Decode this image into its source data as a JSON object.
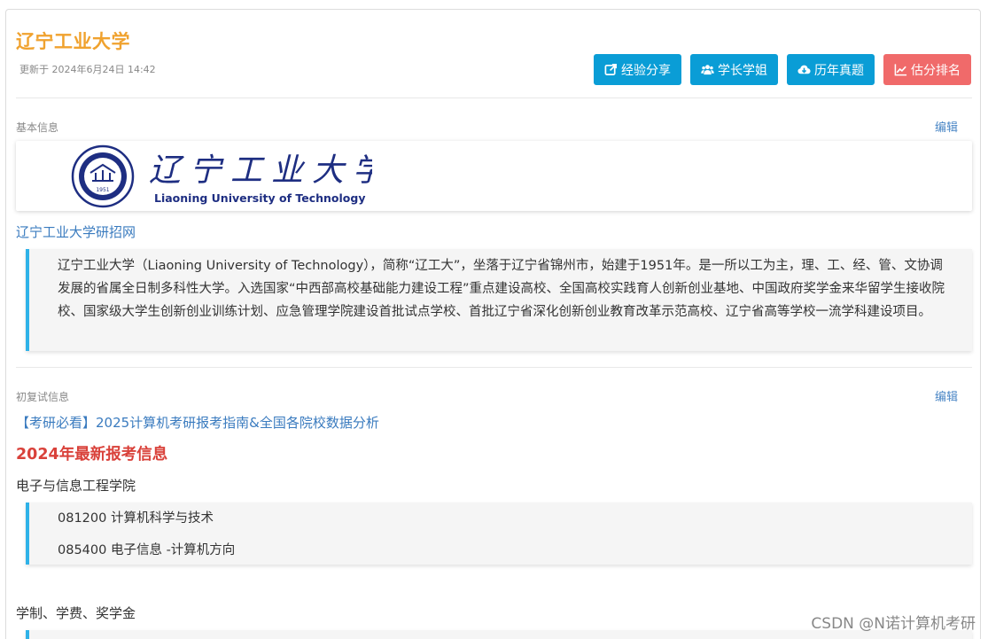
{
  "header": {
    "title": "辽宁工业大学",
    "updated": "更新于 2024年6月24日 14:42"
  },
  "buttons": [
    {
      "label": "经验分享",
      "icon": "share-icon",
      "color": "#0a9dd6"
    },
    {
      "label": "学长学姐",
      "icon": "users-icon",
      "color": "#0a9dd6"
    },
    {
      "label": "历年真题",
      "icon": "cloud-download-icon",
      "color": "#0a9dd6"
    },
    {
      "label": "估分排名",
      "icon": "chart-line-icon",
      "color": "#f06a6a"
    }
  ],
  "basic": {
    "label": "基本信息",
    "edit": "编辑",
    "logo_cn": "辽宁工业大学",
    "logo_en": "Liaoning University of Technology",
    "seal_year": "1951",
    "link": "辽宁工业大学研招网",
    "description": "辽宁工业大学（Liaoning University of Technology），简称“辽工大”，坐落于辽宁省锦州市，始建于1951年。是一所以工为主，理、工、经、管、文协调发展的省属全日制多科性大学。入选国家“中西部高校基础能力建设工程”重点建设高校、全国高校实践育人创新创业基地、中国政府奖学金来华留学生接收院校、国家级大学生创新创业训练计划、应急管理学院建设首批试点学校、首批辽宁省深化创新创业教育改革示范高校、辽宁省高等学校一流学科建设项目。"
  },
  "exam": {
    "label": "初复试信息",
    "edit": "编辑",
    "article_link": "【考研必看】2025计算机考研报考指南&全国各院校数据分析",
    "heading": "2024年最新报考信息",
    "college": "电子与信息工程学院",
    "majors": [
      "081200 计算机科学与技术",
      "085400 电子信息 -计算机方向"
    ],
    "tuition_heading": "学制、学费、奖学金"
  },
  "watermark": "CSDN @N诺计算机考研",
  "colors": {
    "title": "#f0a22e",
    "button_blue": "#0a9dd6",
    "button_red": "#f06a6a",
    "link": "#3a7bbf",
    "quote_bar": "#2fb2e8",
    "red_heading": "#d9413a"
  }
}
